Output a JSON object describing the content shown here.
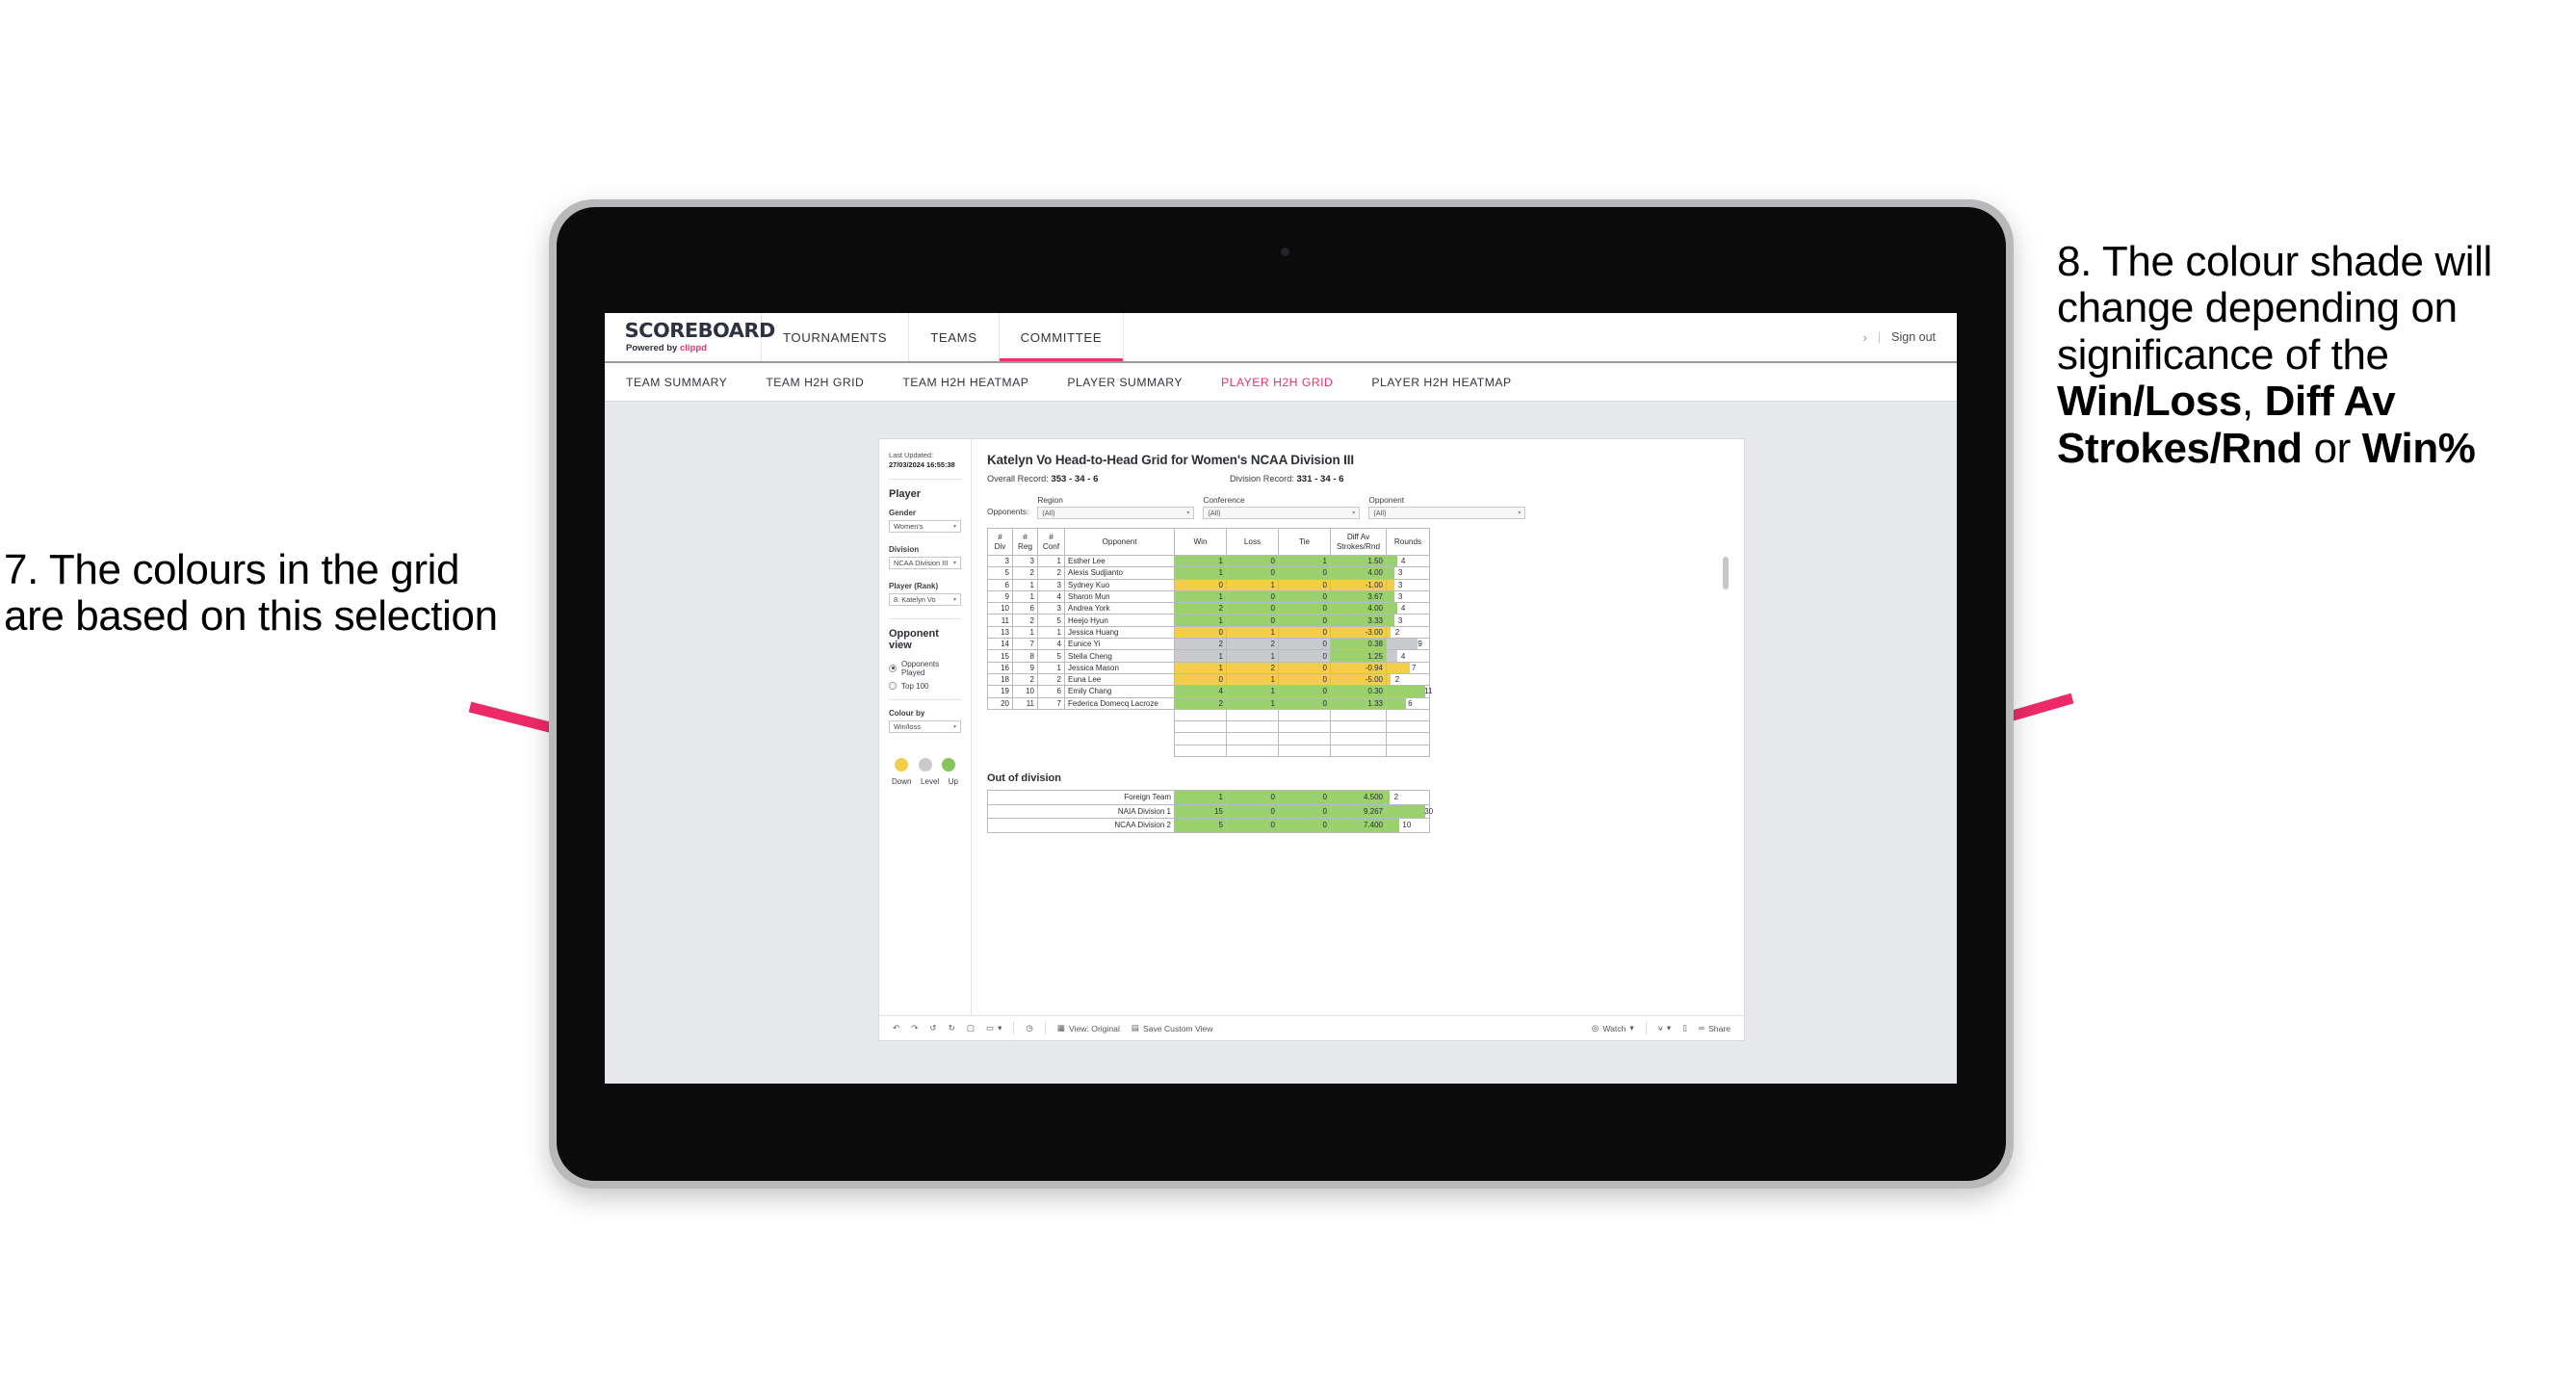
{
  "annotations": {
    "left": "7. The colours in the grid are based on this selection",
    "right_parts": [
      {
        "t": "8. The colour shade will change depending on significance of the ",
        "b": false
      },
      {
        "t": "Win/Loss",
        "b": true
      },
      {
        "t": ", ",
        "b": false
      },
      {
        "t": "Diff Av Strokes/Rnd",
        "b": true
      },
      {
        "t": " or ",
        "b": false
      },
      {
        "t": "Win%",
        "b": true
      }
    ],
    "arrow_color": "#ed2a68"
  },
  "app": {
    "logo_word": "SCOREBOARD",
    "logo_sub_prefix": "Powered by ",
    "logo_brand": "clippd",
    "top_nav": [
      {
        "label": "TOURNAMENTS",
        "active": false
      },
      {
        "label": "TEAMS",
        "active": false
      },
      {
        "label": "COMMITTEE",
        "active": true
      }
    ],
    "chevron_icon": "›",
    "sign_out": "Sign out",
    "sub_nav": [
      {
        "label": "TEAM SUMMARY",
        "active": false
      },
      {
        "label": "TEAM H2H GRID",
        "active": false
      },
      {
        "label": "TEAM H2H HEATMAP",
        "active": false
      },
      {
        "label": "PLAYER SUMMARY",
        "active": false
      },
      {
        "label": "PLAYER H2H GRID",
        "active": true
      },
      {
        "label": "PLAYER H2H HEATMAP",
        "active": false
      }
    ],
    "accent": "#e8336d"
  },
  "panel": {
    "last_updated_label": "Last Updated: ",
    "last_updated_value": "27/03/2024 16:55:38",
    "section_player": "Player",
    "gender_label": "Gender",
    "gender_value": "Women's",
    "division_label": "Division",
    "division_value": "NCAA Division III",
    "player_label": "Player (Rank)",
    "player_value": "8. Katelyn Vo",
    "opponent_view_label": "Opponent view",
    "opponent_view_options": [
      {
        "label": "Opponents Played",
        "selected": true
      },
      {
        "label": "Top 100",
        "selected": false
      }
    ],
    "colour_by_label": "Colour by",
    "colour_by_value": "Win/loss",
    "legend": [
      {
        "label": "Down",
        "color": "#f2ce49"
      },
      {
        "label": "Level",
        "color": "#c9cace"
      },
      {
        "label": "Up",
        "color": "#9ad06e"
      }
    ]
  },
  "viz": {
    "title": "Katelyn Vo Head-to-Head Grid for Women's NCAA Division III",
    "overall_record_label": "Overall Record: ",
    "overall_record_value": "353 - 34 - 6",
    "division_record_label": "Division Record: ",
    "division_record_value": "331 - 34 - 6",
    "opponents_label": "Opponents:",
    "filters": [
      {
        "caption": "Region",
        "value": "(All)"
      },
      {
        "caption": "Conference",
        "value": "(All)"
      },
      {
        "caption": "Opponent",
        "value": "(All)"
      }
    ],
    "out_of_division_title": "Out of division"
  },
  "chart_data": {
    "type": "table",
    "title": "Katelyn Vo Head-to-Head Grid for Women's NCAA Division III",
    "columns": [
      "# Div",
      "# Reg",
      "# Conf",
      "Opponent",
      "Win",
      "Loss",
      "Tie",
      "Diff Av Strokes/Rnd",
      "Rounds"
    ],
    "header_lines": [
      [
        "#",
        "Div"
      ],
      [
        "#",
        "Reg"
      ],
      [
        "#",
        "Conf"
      ],
      [
        "Opponent",
        ""
      ],
      [
        "Win",
        ""
      ],
      [
        "Loss",
        ""
      ],
      [
        "Tie",
        ""
      ],
      [
        "Diff Av",
        "Strokes/Rnd"
      ],
      [
        "Rounds",
        ""
      ]
    ],
    "rows": [
      {
        "div": "3",
        "reg": "3",
        "conf": "1",
        "opponent": "Esther Lee",
        "win": "1",
        "loss": "0",
        "tie": "1",
        "diff": "1.50",
        "rounds": "4",
        "shade": "g",
        "bar_pct": 26
      },
      {
        "div": "5",
        "reg": "2",
        "conf": "2",
        "opponent": "Alexis Sudjianto",
        "win": "1",
        "loss": "0",
        "tie": "0",
        "diff": "4.00",
        "rounds": "3",
        "shade": "g",
        "bar_pct": 18
      },
      {
        "div": "6",
        "reg": "1",
        "conf": "3",
        "opponent": "Sydney Kuo",
        "win": "0",
        "loss": "1",
        "tie": "0",
        "diff": "-1.00",
        "rounds": "3",
        "shade": "y",
        "bar_pct": 18
      },
      {
        "div": "9",
        "reg": "1",
        "conf": "4",
        "opponent": "Sharon Mun",
        "win": "1",
        "loss": "0",
        "tie": "0",
        "diff": "3.67",
        "rounds": "3",
        "shade": "g",
        "bar_pct": 18
      },
      {
        "div": "10",
        "reg": "6",
        "conf": "3",
        "opponent": "Andrea York",
        "win": "2",
        "loss": "0",
        "tie": "0",
        "diff": "4.00",
        "rounds": "4",
        "shade": "g",
        "bar_pct": 26
      },
      {
        "div": "11",
        "reg": "2",
        "conf": "5",
        "opponent": "Heejo Hyun",
        "win": "1",
        "loss": "0",
        "tie": "0",
        "diff": "3.33",
        "rounds": "3",
        "shade": "g",
        "bar_pct": 18
      },
      {
        "div": "13",
        "reg": "1",
        "conf": "1",
        "opponent": "Jessica Huang",
        "win": "0",
        "loss": "1",
        "tie": "0",
        "diff": "-3.00",
        "rounds": "2",
        "shade": "y",
        "bar_pct": 10
      },
      {
        "div": "14",
        "reg": "7",
        "conf": "4",
        "opponent": "Eunice Yi",
        "win": "2",
        "loss": "2",
        "tie": "0",
        "diff": "0.38",
        "rounds": "9",
        "shade": "gr",
        "diff_shade": "g",
        "bar_pct": 72
      },
      {
        "div": "15",
        "reg": "8",
        "conf": "5",
        "opponent": "Stella Cheng",
        "win": "1",
        "loss": "1",
        "tie": "0",
        "diff": "1.25",
        "rounds": "4",
        "shade": "gr",
        "diff_shade": "g",
        "bar_pct": 26
      },
      {
        "div": "16",
        "reg": "9",
        "conf": "1",
        "opponent": "Jessica Mason",
        "win": "1",
        "loss": "2",
        "tie": "0",
        "diff": "-0.94",
        "rounds": "7",
        "shade": "y",
        "bar_pct": 55
      },
      {
        "div": "18",
        "reg": "2",
        "conf": "2",
        "opponent": "Euna Lee",
        "win": "0",
        "loss": "1",
        "tie": "0",
        "diff": "-5.00",
        "rounds": "2",
        "shade": "y",
        "bar_pct": 10
      },
      {
        "div": "19",
        "reg": "10",
        "conf": "6",
        "opponent": "Emily Chang",
        "win": "4",
        "loss": "1",
        "tie": "0",
        "diff": "0.30",
        "rounds": "11",
        "shade": "g",
        "bar_pct": 90
      },
      {
        "div": "20",
        "reg": "11",
        "conf": "7",
        "opponent": "Federica Domecq Lacroze",
        "win": "2",
        "loss": "1",
        "tie": "0",
        "diff": "1.33",
        "rounds": "6",
        "shade": "g",
        "bar_pct": 45
      }
    ],
    "out_of_division_rows": [
      {
        "label": "Foreign Team",
        "win": "1",
        "loss": "0",
        "tie": "0",
        "diff": "4.500",
        "rounds": "2",
        "shade": "g",
        "bar_pct": 7
      },
      {
        "label": "NAIA Division 1",
        "win": "15",
        "loss": "0",
        "tie": "0",
        "diff": "9.267",
        "rounds": "30",
        "shade": "g",
        "bar_pct": 90
      },
      {
        "label": "NCAA Division 2",
        "win": "5",
        "loss": "0",
        "tie": "0",
        "diff": "7.400",
        "rounds": "10",
        "shade": "g",
        "bar_pct": 30
      }
    ],
    "colors": {
      "up": "#9ad06e",
      "down": "#f2ce49",
      "level": "#c9cace"
    }
  },
  "toolbar": {
    "undo_icon": "↶",
    "redo_icon": "↷",
    "revert_icon": "↺",
    "refresh_icon": "↻",
    "pause_icon": "⏸",
    "view_label": "View: Original",
    "save_label": "Save Custom View",
    "watch_label": "Watch",
    "share_label": "Share",
    "caret": "▾"
  }
}
